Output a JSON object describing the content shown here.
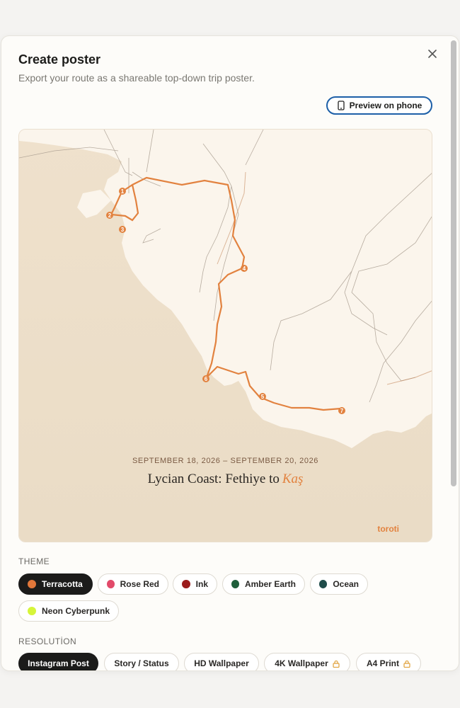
{
  "modal": {
    "title": "Create poster",
    "subtitle": "Export your route as a shareable top-down trip poster.",
    "close_icon": "close-icon",
    "preview_button": {
      "label": "Preview on phone",
      "icon": "phone-icon",
      "border_color": "#1d5fa8"
    }
  },
  "poster": {
    "dates": "SEPTEMBER 18, 2026 – SEPTEMBER 20, 2026",
    "title_main": "Lycian Coast: Fethiye to",
    "title_accent": "Kaş",
    "brand": "toroti",
    "route_color": "#e2823f",
    "stops": [
      "1",
      "2",
      "3",
      "4",
      "5",
      "6",
      "7"
    ]
  },
  "theme": {
    "label": "THEME",
    "options": [
      {
        "label": "Terracotta",
        "color": "#e2773a",
        "selected": true
      },
      {
        "label": "Rose Red",
        "color": "#e24a6a",
        "selected": false
      },
      {
        "label": "Ink",
        "color": "#9b1c1c",
        "selected": false
      },
      {
        "label": "Amber Earth",
        "color": "#1e5e3a",
        "selected": false
      },
      {
        "label": "Ocean",
        "color": "#1f4c4a",
        "selected": false
      },
      {
        "label": "Neon Cyberpunk",
        "color": "#d6f53a",
        "selected": false
      }
    ]
  },
  "resolution": {
    "label": "RESOLUTİON",
    "options": [
      {
        "label": "Instagram Post",
        "selected": true,
        "locked": false
      },
      {
        "label": "Story / Status",
        "selected": false,
        "locked": false
      },
      {
        "label": "HD Wallpaper",
        "selected": false,
        "locked": false
      },
      {
        "label": "4K Wallpaper",
        "selected": false,
        "locked": true
      },
      {
        "label": "A4 Print",
        "selected": false,
        "locked": true
      }
    ],
    "lock_icon": "lock-icon",
    "lock_color": "#e0a13a"
  }
}
